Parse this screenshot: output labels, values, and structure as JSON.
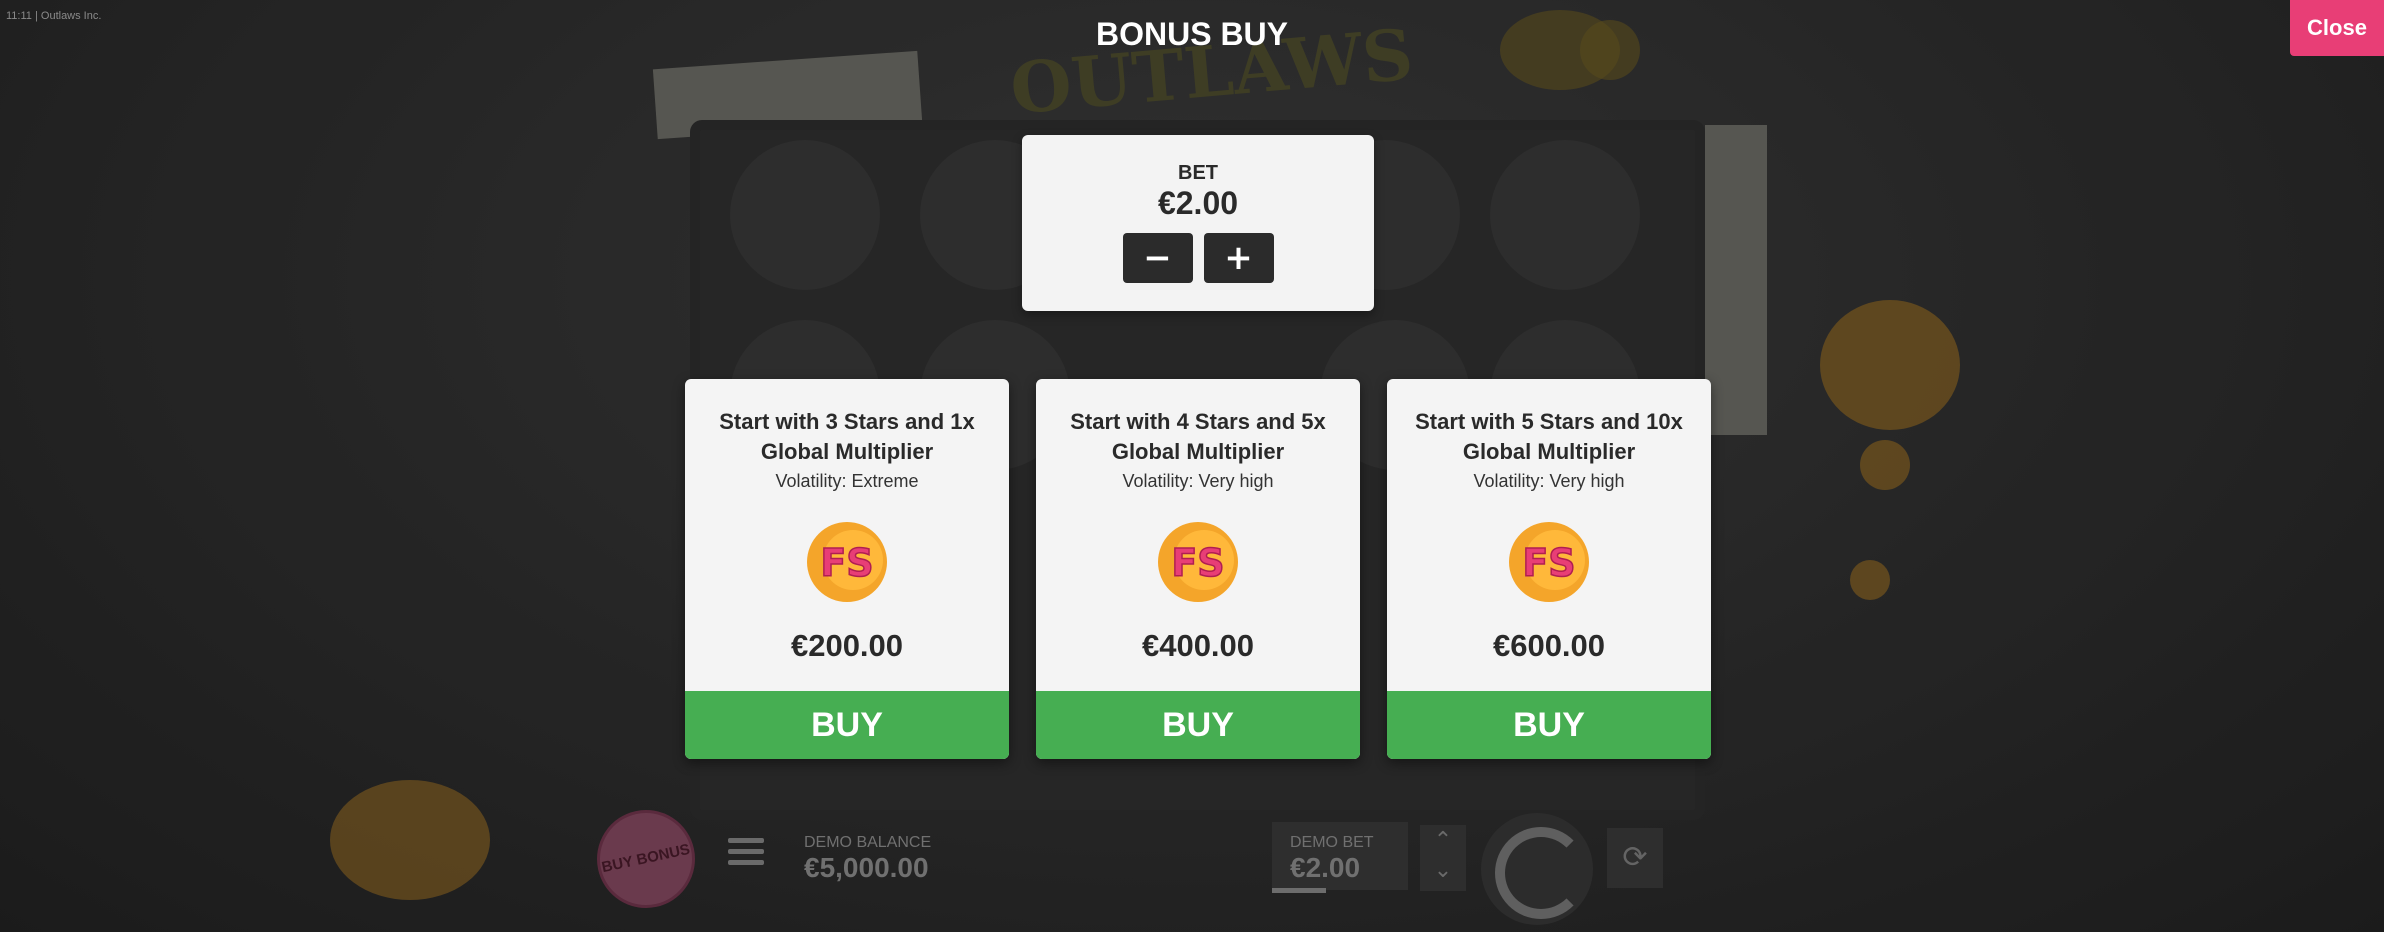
{
  "status": {
    "time": "11:11",
    "separator": "|",
    "app_name": "Outlaws Inc."
  },
  "header": {
    "title": "BONUS BUY",
    "close_label": "Close"
  },
  "bet": {
    "label": "BET",
    "value": "€2.00",
    "decrease_symbol": "−",
    "increase_symbol": "+"
  },
  "offers": [
    {
      "title": "Start with 3 Stars and 1x Global Multiplier",
      "volatility": "Volatility: Extreme",
      "icon": "FS",
      "price": "€200.00",
      "buy_label": "BUY"
    },
    {
      "title": "Start with 4 Stars and 5x Global Multiplier",
      "volatility": "Volatility: Very high",
      "icon": "FS",
      "price": "€400.00",
      "buy_label": "BUY"
    },
    {
      "title": "Start with 5 Stars and 10x Global Multiplier",
      "volatility": "Volatility: Very high",
      "icon": "FS",
      "price": "€600.00",
      "buy_label": "BUY"
    }
  ],
  "game_hud": {
    "buy_bonus_label": "BUY BONUS",
    "balance_label": "DEMO BALANCE",
    "balance_value": "€5,000.00",
    "bet_label": "DEMO BET",
    "bet_value": "€2.00"
  },
  "colors": {
    "accent_close": "#e83e76",
    "buy_green": "#46ae52",
    "panel_bg": "#f4f4f4",
    "icon_pink": "#e83e76",
    "icon_orange": "#f4a52a"
  }
}
